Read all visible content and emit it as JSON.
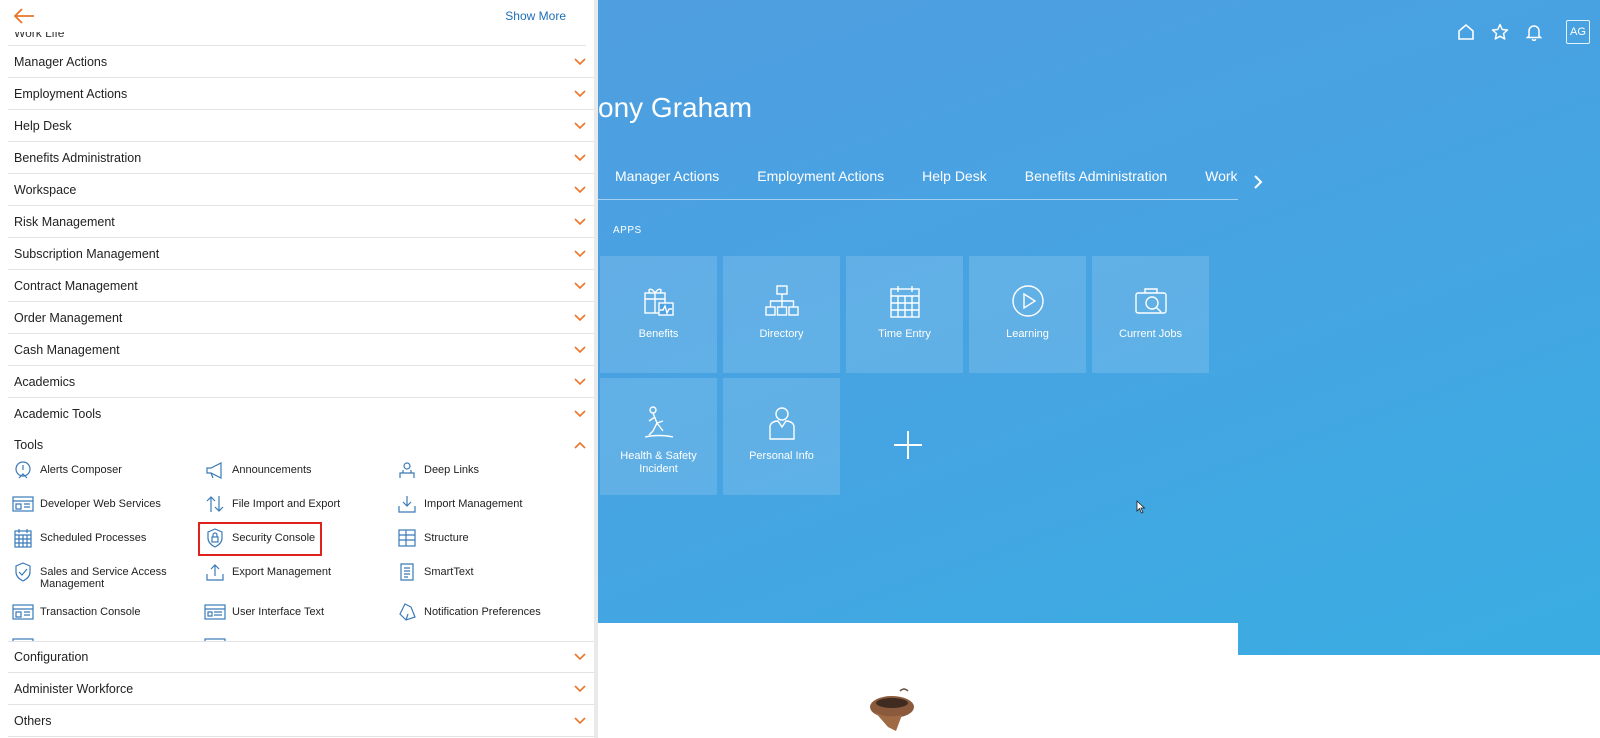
{
  "drawer": {
    "show_more": "Show More",
    "cut_top_label": "Work Life",
    "groups_top": [
      {
        "label": "Manager Actions"
      },
      {
        "label": "Employment Actions"
      },
      {
        "label": "Help Desk"
      },
      {
        "label": "Benefits Administration"
      },
      {
        "label": "Workspace"
      },
      {
        "label": "Risk Management"
      },
      {
        "label": "Subscription Management"
      },
      {
        "label": "Contract Management"
      },
      {
        "label": "Order Management"
      },
      {
        "label": "Cash Management"
      },
      {
        "label": "Academics"
      },
      {
        "label": "Academic Tools"
      }
    ],
    "tools": {
      "label": "Tools",
      "items": [
        {
          "label": "Alerts Composer",
          "icon": "alert-composer-icon"
        },
        {
          "label": "Announcements",
          "icon": "megaphone-icon"
        },
        {
          "label": "Deep Links",
          "icon": "deep-links-icon"
        },
        {
          "label": "Developer Web Services",
          "icon": "developer-icon"
        },
        {
          "label": "File Import and Export",
          "icon": "import-export-icon"
        },
        {
          "label": "Import Management",
          "icon": "import-icon"
        },
        {
          "label": "Scheduled Processes",
          "icon": "calendar-icon"
        },
        {
          "label": "Security Console",
          "icon": "shield-icon"
        },
        {
          "label": "Structure",
          "icon": "structure-icon"
        },
        {
          "label": "Sales and Service Access Management",
          "icon": "shield-check-icon"
        },
        {
          "label": "Export Management",
          "icon": "export-icon"
        },
        {
          "label": "SmartText",
          "icon": "document-icon"
        },
        {
          "label": "Transaction Console",
          "icon": "console-icon"
        },
        {
          "label": "User Interface Text",
          "icon": "ui-text-icon"
        },
        {
          "label": "Notification Preferences",
          "icon": "notification-icon"
        }
      ]
    },
    "groups_bottom": [
      {
        "label": "Configuration"
      },
      {
        "label": "Administer Workforce"
      },
      {
        "label": "Others"
      }
    ]
  },
  "home": {
    "greeting": "ony Graham",
    "avatar": "AG",
    "tabs": [
      "Manager Actions",
      "Employment Actions",
      "Help Desk",
      "Benefits Administration",
      "Workspa"
    ],
    "apps_label": "APPS",
    "tiles": [
      {
        "label": "Benefits",
        "icon": "benefits-icon"
      },
      {
        "label": "Directory",
        "icon": "directory-icon"
      },
      {
        "label": "Time Entry",
        "icon": "time-entry-icon"
      },
      {
        "label": "Learning",
        "icon": "learning-icon"
      },
      {
        "label": "Current Jobs",
        "icon": "current-jobs-icon"
      },
      {
        "label": "Health & Safety Incident",
        "icon": "health-safety-icon"
      },
      {
        "label": "Personal Info",
        "icon": "personal-info-icon"
      }
    ]
  },
  "colors": {
    "accent_orange": "#e8762c",
    "link_blue": "#1d6fb8",
    "highlight_red": "#e0221c",
    "icon_blue": "#3a7ab8",
    "home_blue": "#47a3e2"
  }
}
